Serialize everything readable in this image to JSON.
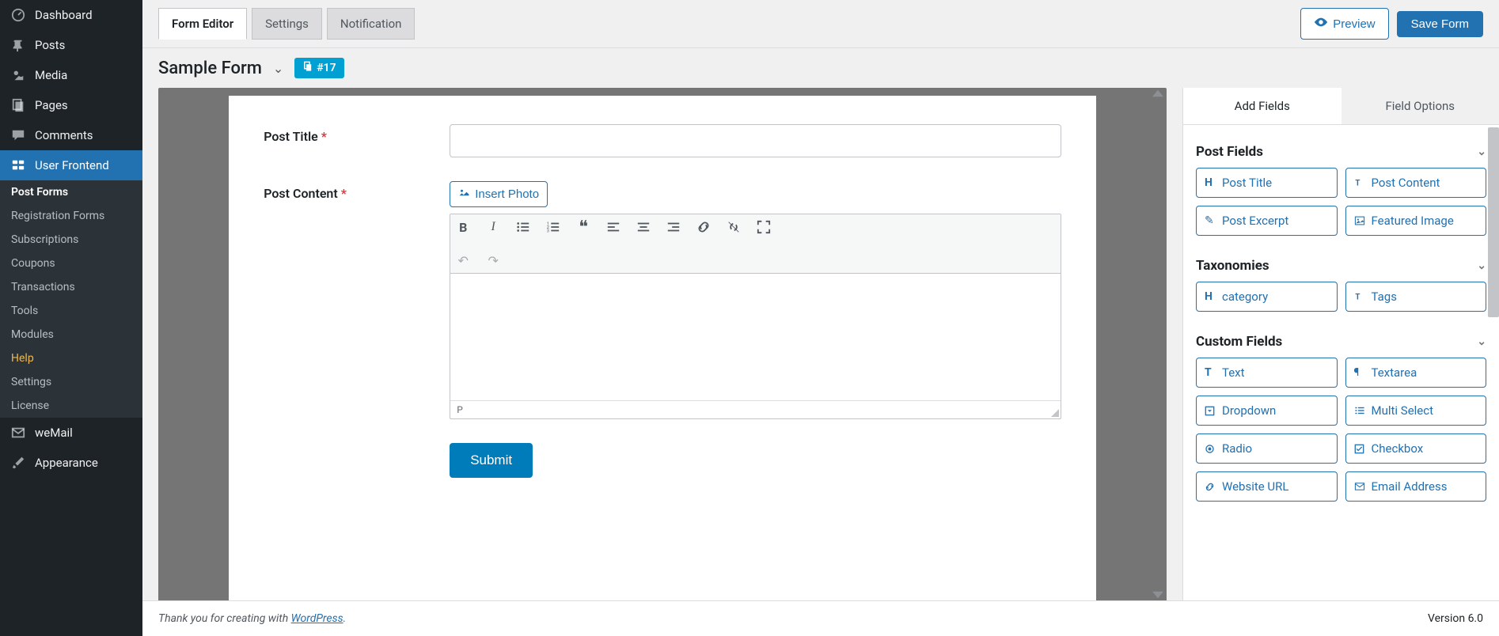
{
  "sidebar": {
    "dashboard": "Dashboard",
    "posts": "Posts",
    "media": "Media",
    "pages": "Pages",
    "comments": "Comments",
    "user_frontend": "User Frontend",
    "sub": {
      "post_forms": "Post Forms",
      "registration_forms": "Registration Forms",
      "subscriptions": "Subscriptions",
      "coupons": "Coupons",
      "transactions": "Transactions",
      "tools": "Tools",
      "modules": "Modules",
      "help": "Help",
      "settings": "Settings",
      "license": "License"
    },
    "wemail": "weMail",
    "appearance": "Appearance"
  },
  "tabs": {
    "form_editor": "Form Editor",
    "settings": "Settings",
    "notification": "Notification"
  },
  "actions": {
    "preview": "Preview",
    "save": "Save Form"
  },
  "form": {
    "title": "Sample Form",
    "id_badge": "#17",
    "post_title_label": "Post Title",
    "post_content_label": "Post Content",
    "insert_photo": "Insert Photo",
    "status_path": "P",
    "submit": "Submit"
  },
  "right": {
    "add_fields": "Add Fields",
    "field_options": "Field Options",
    "post_fields": "Post Fields",
    "taxonomies": "Taxonomies",
    "custom_fields": "Custom Fields",
    "pf": {
      "post_title": "Post Title",
      "post_content": "Post Content",
      "post_excerpt": "Post Excerpt",
      "featured_image": "Featured Image"
    },
    "tx": {
      "category": "category",
      "tags": "Tags"
    },
    "cf": {
      "text": "Text",
      "textarea": "Textarea",
      "dropdown": "Dropdown",
      "multi_select": "Multi Select",
      "radio": "Radio",
      "checkbox": "Checkbox",
      "website_url": "Website URL",
      "email_address": "Email Address"
    }
  },
  "footer": {
    "thanks_pre": "Thank you for creating with ",
    "wordpress": "WordPress",
    "version": "Version 6.0"
  }
}
